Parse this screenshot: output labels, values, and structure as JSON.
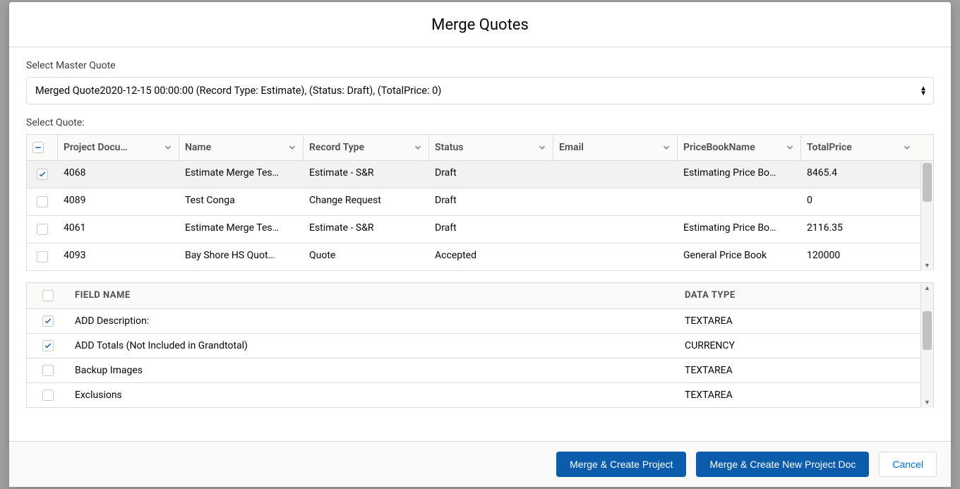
{
  "modal": {
    "title": "Merge Quotes",
    "master_label": "Select Master Quote",
    "master_value": "Merged Quote2020-12-15 00:00:00 (Record Type: Estimate), (Status: Draft), (TotalPrice: 0)",
    "select_quote_label": "Select Quote:"
  },
  "quote_columns": {
    "doc": "Project Docu…",
    "name": "Name",
    "record_type": "Record Type",
    "status": "Status",
    "email": "Email",
    "price_book": "PriceBookName",
    "total": "TotalPrice"
  },
  "quotes": [
    {
      "checked": true,
      "doc": "4068",
      "name": "Estimate Merge Tes…",
      "record_type": "Estimate - S&R",
      "status": "Draft",
      "email": "",
      "price_book": "Estimating Price Bo…",
      "total": "8465.4",
      "selected": true
    },
    {
      "checked": false,
      "doc": "4089",
      "name": "Test Conga",
      "record_type": "Change Request",
      "status": "Draft",
      "email": "",
      "price_book": "",
      "total": "0",
      "selected": false
    },
    {
      "checked": false,
      "doc": "4061",
      "name": "Estimate Merge Tes…",
      "record_type": "Estimate - S&R",
      "status": "Draft",
      "email": "",
      "price_book": "Estimating Price Bo…",
      "total": "2116.35",
      "selected": false
    },
    {
      "checked": false,
      "doc": "4093",
      "name": "Bay Shore HS Quot…",
      "record_type": "Quote",
      "status": "Accepted",
      "email": "",
      "price_book": "General Price Book",
      "total": "120000",
      "selected": false
    }
  ],
  "field_columns": {
    "name": "FIELD NAME",
    "type": "DATA TYPE"
  },
  "fields": [
    {
      "checked": true,
      "name": "ADD Description:",
      "type": "TEXTAREA"
    },
    {
      "checked": true,
      "name": "ADD Totals (Not Included in Grandtotal)",
      "type": "CURRENCY"
    },
    {
      "checked": false,
      "name": "Backup Images",
      "type": "TEXTAREA"
    },
    {
      "checked": false,
      "name": "Exclusions",
      "type": "TEXTAREA"
    }
  ],
  "footer": {
    "merge_project": "Merge & Create Project",
    "merge_doc": "Merge & Create New Project Doc",
    "cancel": "Cancel"
  }
}
